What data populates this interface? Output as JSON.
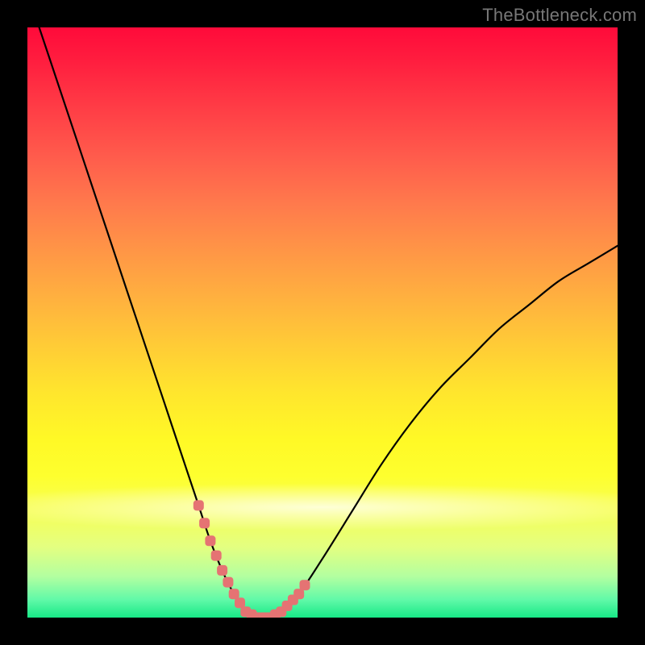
{
  "watermark": "TheBottleneck.com",
  "colors": {
    "page_bg": "#000000",
    "curve_stroke": "#000000",
    "marker_fill": "#e57373",
    "gradient_top": "#ff0a3a",
    "gradient_bottom": "#17e886"
  },
  "chart_data": {
    "type": "line",
    "title": "",
    "xlabel": "",
    "ylabel": "",
    "xlim": [
      0,
      100
    ],
    "ylim": [
      0,
      100
    ],
    "grid": false,
    "legend": false,
    "series": [
      {
        "name": "bottleneck-curve",
        "x": [
          2,
          5,
          8,
          11,
          14,
          17,
          20,
          23,
          26,
          29,
          31,
          33,
          35,
          37,
          39,
          41,
          43,
          46,
          50,
          55,
          60,
          65,
          70,
          75,
          80,
          85,
          90,
          95,
          100
        ],
        "y": [
          100,
          91,
          82,
          73,
          64,
          55,
          46,
          37,
          28,
          19,
          13,
          8,
          4,
          1,
          0,
          0,
          1,
          4,
          10,
          18,
          26,
          33,
          39,
          44,
          49,
          53,
          57,
          60,
          63
        ]
      }
    ],
    "markers": {
      "name": "highlight-points",
      "x": [
        29,
        30,
        31,
        32,
        33,
        34,
        35,
        36,
        37,
        38,
        39,
        40,
        41,
        42,
        43,
        44,
        45,
        46,
        47
      ],
      "y": [
        19,
        16,
        13,
        10.5,
        8,
        6,
        4,
        2.5,
        1,
        0.5,
        0,
        0,
        0,
        0.5,
        1,
        2,
        3,
        4,
        5.5
      ]
    },
    "background_gradient": {
      "orientation": "vertical",
      "stops": [
        {
          "pos": 0.0,
          "color": "#ff0a3a"
        },
        {
          "pos": 0.5,
          "color": "#ffcc36"
        },
        {
          "pos": 0.75,
          "color": "#feff2e"
        },
        {
          "pos": 1.0,
          "color": "#17e886"
        }
      ]
    }
  }
}
